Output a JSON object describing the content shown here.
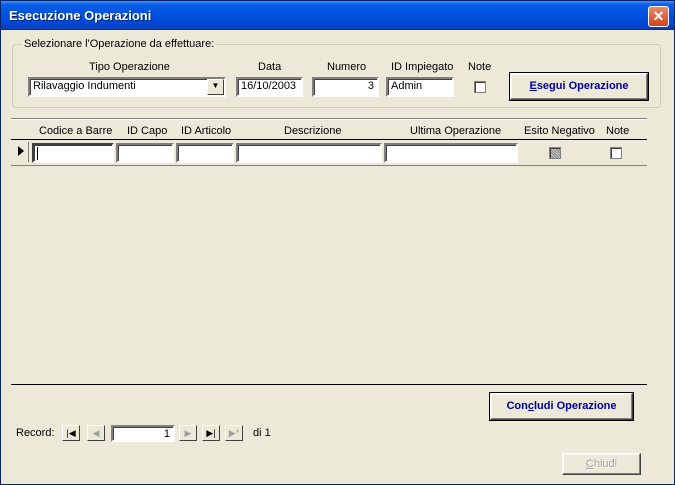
{
  "window": {
    "title": "Esecuzione Operazioni"
  },
  "group": {
    "caption": "Selezionare l'Operazione da effettuare:",
    "tipo": {
      "label": "Tipo Operazione",
      "value": "Rilavaggio Indumenti"
    },
    "data": {
      "label": "Data",
      "value": "16/10/2003"
    },
    "numero": {
      "label": "Numero",
      "value": "3"
    },
    "impiegato": {
      "label": "ID Impiegato",
      "value": "Admin"
    },
    "note": {
      "label": "Note"
    },
    "esegui_pre": "E",
    "esegui_rest": "segui Operazione"
  },
  "grid": {
    "headers": [
      "Codice a Barre",
      "ID Capo",
      "ID Articolo",
      "Descrizione",
      "Ultima Operazione",
      "Esito Negativo",
      "Note"
    ],
    "row": [
      "",
      "",
      "",
      "",
      ""
    ]
  },
  "concludi": {
    "pre": "Con",
    "u": "c",
    "rest": "ludi Operazione"
  },
  "record": {
    "label": "Record:",
    "current": "1",
    "total": "di 1"
  },
  "chiudi": {
    "u": "C",
    "rest": "hiudi"
  }
}
